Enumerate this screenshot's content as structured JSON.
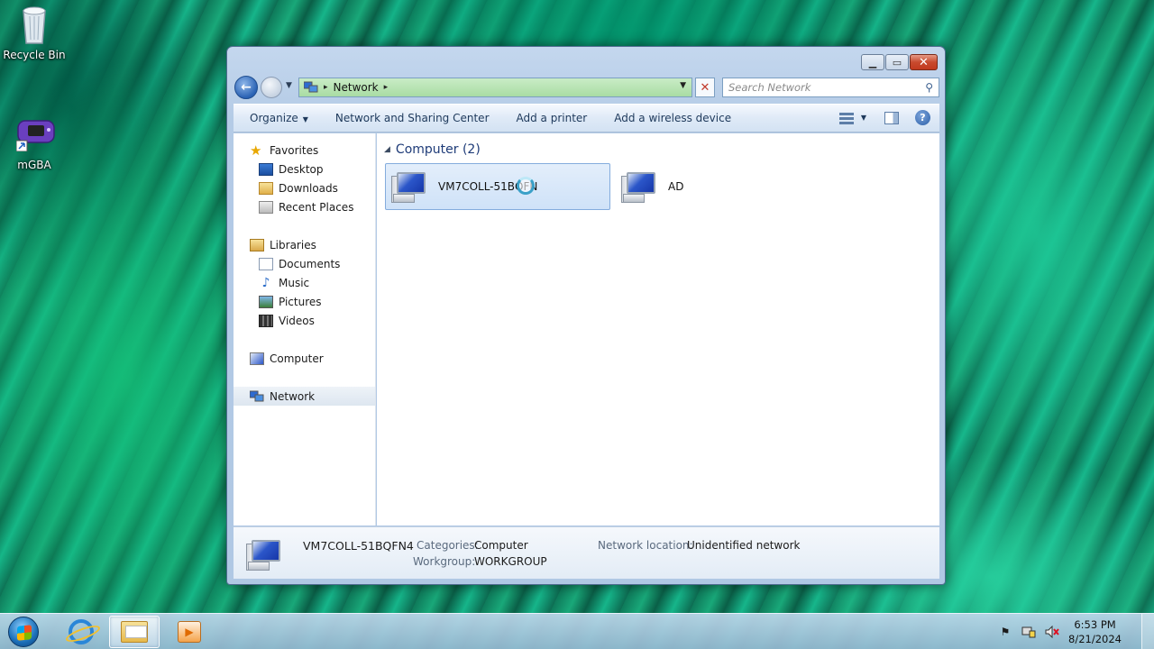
{
  "desktop": {
    "icons": [
      {
        "label": "Recycle Bin",
        "icon": "recycle-bin-icon"
      },
      {
        "label": "mGBA",
        "icon": "mgba-icon"
      }
    ]
  },
  "window": {
    "controls": {
      "minimize": "minimize",
      "maximize": "maximize",
      "close": "close"
    },
    "address": {
      "crumb": "Network",
      "separator": "▸"
    },
    "search": {
      "placeholder": "Search Network"
    },
    "command_bar": {
      "organize": "Organize",
      "network_sharing": "Network and Sharing Center",
      "add_printer": "Add a printer",
      "add_wireless": "Add a wireless device"
    },
    "nav": {
      "favorites": "Favorites",
      "desktop": "Desktop",
      "downloads": "Downloads",
      "recent_places": "Recent Places",
      "libraries": "Libraries",
      "documents": "Documents",
      "music": "Music",
      "pictures": "Pictures",
      "videos": "Videos",
      "computer": "Computer",
      "network": "Network"
    },
    "content": {
      "group_header": "Computer (2)",
      "items": [
        {
          "name": "VM7COLL-51BQFN4",
          "display": "VM7COLL-51BQFN",
          "selected": true
        },
        {
          "name": "AD",
          "display": "AD",
          "selected": false
        }
      ]
    },
    "details": {
      "name": "VM7COLL-51BQFN4",
      "categories_label": "Categories:",
      "categories_value": "Computer",
      "workgroup_label": "Workgroup:",
      "workgroup_value": "WORKGROUP",
      "location_label": "Network location:",
      "location_value": "Unidentified network"
    }
  },
  "taskbar": {
    "pinned": [
      "Internet Explorer",
      "Windows Explorer",
      "Windows Media Player"
    ],
    "clock": {
      "time": "6:53 PM",
      "date": "8/21/2024"
    },
    "tray_icons": [
      "action-center-flag-icon",
      "network-icon",
      "volume-muted-icon"
    ]
  }
}
